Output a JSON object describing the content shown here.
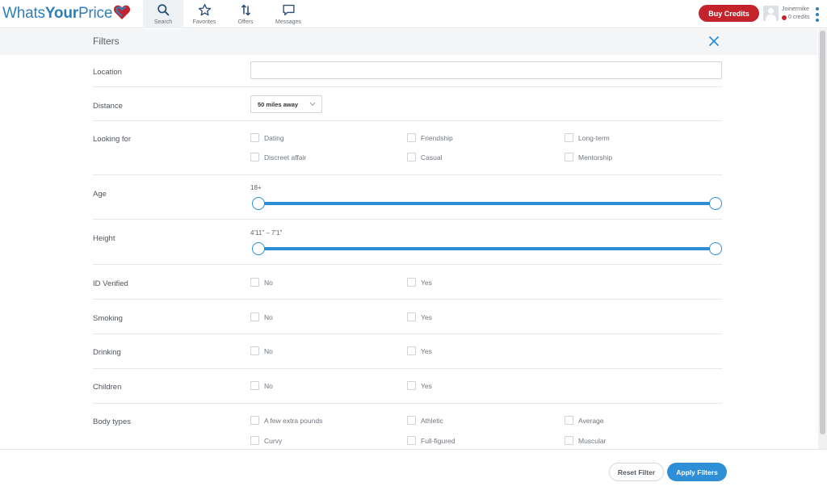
{
  "brand": {
    "part1": "Whats",
    "part2": "Your",
    "part3": "Price",
    "accent": "#2f7fb8",
    "heart_color": "#c4232c"
  },
  "nav": [
    {
      "label": "Search",
      "icon": "search-icon",
      "active": true
    },
    {
      "label": "Favorites",
      "icon": "star-icon",
      "active": false
    },
    {
      "label": "Offers",
      "icon": "sort-arrows-icon",
      "active": false
    },
    {
      "label": "Messages",
      "icon": "chat-bubble-icon",
      "active": false
    }
  ],
  "account": {
    "buy_label": "Buy Credits",
    "username": "Joinermike",
    "credits": "0 credits"
  },
  "filters": {
    "title": "Filters",
    "location": {
      "label": "Location",
      "value": "",
      "placeholder": ""
    },
    "distance": {
      "label": "Distance",
      "selected": "50 miles away"
    },
    "looking_for": {
      "label": "Looking for",
      "options": [
        "Dating",
        "Friendship",
        "Long-term",
        "Discreet affair",
        "Casual",
        "Mentorship"
      ]
    },
    "age": {
      "label": "Age",
      "value_text": "18+",
      "min_fraction": 0,
      "max_fraction": 1
    },
    "height": {
      "label": "Height",
      "value_text": "4'11\" – 7'1\"",
      "min_fraction": 0,
      "max_fraction": 1
    },
    "id_verified": {
      "label": "ID Verified",
      "options": [
        "No",
        "Yes"
      ]
    },
    "smoking": {
      "label": "Smoking",
      "options": [
        "No",
        "Yes"
      ]
    },
    "drinking": {
      "label": "Drinking",
      "options": [
        "No",
        "Yes"
      ]
    },
    "children": {
      "label": "Children",
      "options": [
        "No",
        "Yes"
      ]
    },
    "body_types": {
      "label": "Body types",
      "options": [
        "A few extra pounds",
        "Athletic",
        "Average",
        "Curvy",
        "Full-figured",
        "Muscular"
      ]
    }
  },
  "footer": {
    "reset_label": "Reset Filter",
    "apply_label": "Apply Filters"
  },
  "colors": {
    "primary_blue": "#2f8fd6",
    "buy_red": "#c4232c"
  }
}
